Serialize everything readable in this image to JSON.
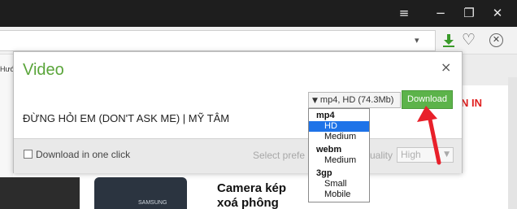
{
  "window": {
    "minimize_icon": "minimize-icon",
    "restore_icon": "restore-icon",
    "close_icon": "close-icon"
  },
  "page_behind": {
    "left_text": "Hướ",
    "red_text": "N IN",
    "ad_headline": "Camera kép xoá phông",
    "phone_label": "SAMSUNG"
  },
  "dialog": {
    "title": "Video",
    "close_label": "×",
    "video_name": "ĐỪNG HỎI EM (DON'T ASK ME) | MỸ TÂM",
    "selected_format": "mp4, HD (74.3Mb)",
    "download_label": "Download",
    "download_in_one_click": "Download in one click",
    "select_preferred": "Select prefe",
    "quality_label": "uality",
    "quality_value": "High",
    "format_options": [
      {
        "group": "mp4",
        "items": [
          "HD",
          "Medium"
        ]
      },
      {
        "group": "webm",
        "items": [
          "Medium"
        ]
      },
      {
        "group": "3gp",
        "items": [
          "Small",
          "Mobile"
        ]
      }
    ],
    "highlighted_option": "HD"
  },
  "colors": {
    "accent_green": "#5cb34a",
    "title_green": "#5aa53a",
    "selection_blue": "#1e73e8",
    "arrow_red": "#e8202a"
  }
}
